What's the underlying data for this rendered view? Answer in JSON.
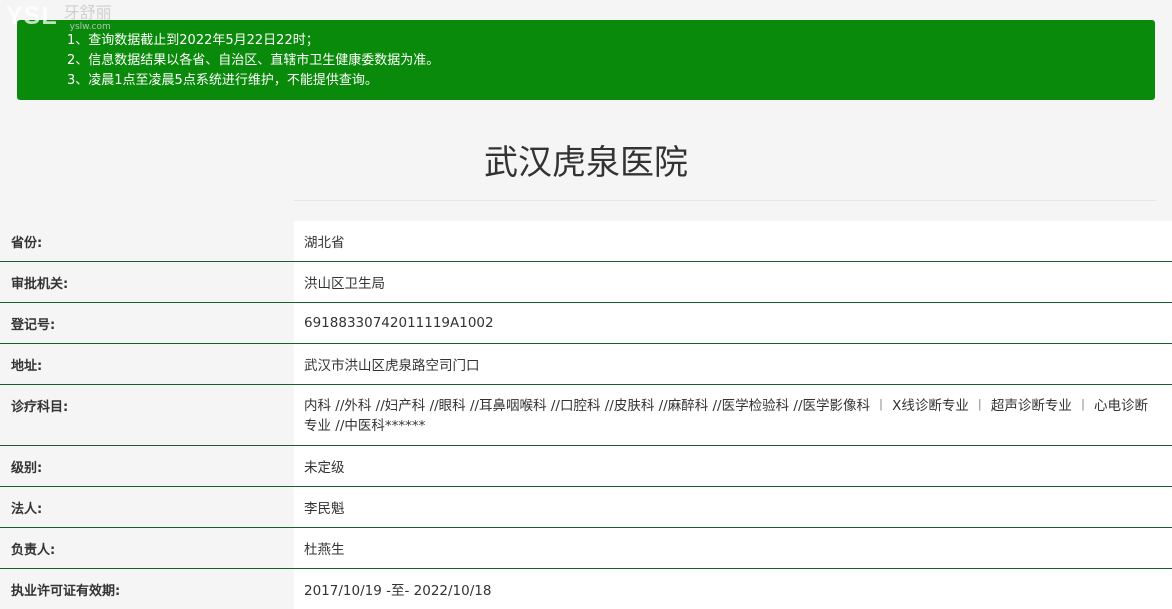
{
  "watermark": {
    "logo": "YSL",
    "chinese": "牙舒丽",
    "url": "yslw.com"
  },
  "notice": {
    "lines": [
      "1、查询数据截止到2022年5月22日22时；",
      "2、信息数据结果以各省、自治区、直辖市卫生健康委数据为准。",
      "3、凌晨1点至凌晨5点系统进行维护，不能提供查询。"
    ],
    "background_color": "#0a8a0a"
  },
  "hospital": {
    "name": "武汉虎泉医院"
  },
  "details": [
    {
      "label": "省份:",
      "value": "湖北省"
    },
    {
      "label": "审批机关:",
      "value": "洪山区卫生局"
    },
    {
      "label": "登记号:",
      "value": "69188330742011119A1002"
    },
    {
      "label": "地址:",
      "value": "武汉市洪山区虎泉路空司门口"
    },
    {
      "label": "诊疗科目:",
      "value": "内科 //外科 //妇产科 //眼科 //耳鼻咽喉科 //口腔科 //皮肤科 //麻醉科 //医学检验科 //医学影像科 ︱ X线诊断专业 ︱ 超声诊断专业 ︱ 心电诊断专业 //中医科******"
    },
    {
      "label": "级别:",
      "value": "未定级"
    },
    {
      "label": "法人:",
      "value": "李民魁"
    },
    {
      "label": "负责人:",
      "value": "杜燕生"
    },
    {
      "label": "执业许可证有效期:",
      "value": "2017/10/19 -至- 2022/10/18"
    }
  ],
  "colors": {
    "row_divider": "#1c5c35",
    "page_background": "#f5f5f5"
  }
}
